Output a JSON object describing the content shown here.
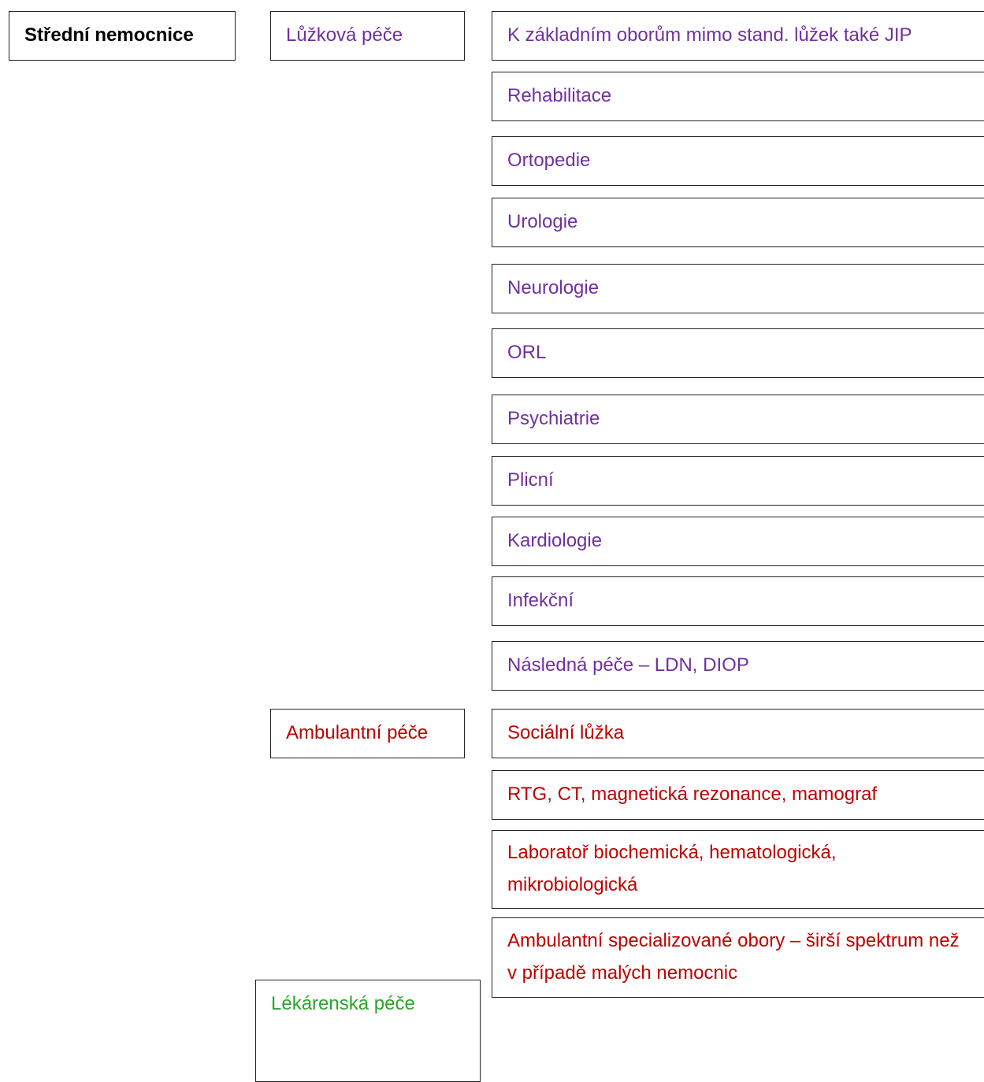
{
  "root": {
    "label": "Střední nemocnice"
  },
  "colors": {
    "inpatient": "#7030a0",
    "ambulatory": "#c00000",
    "pharmacy": "#2aa52a"
  },
  "categories": [
    {
      "label": "Lůžková péče",
      "items": [
        "K základním oborům mimo stand. lůžek také JIP",
        "Rehabilitace",
        "Ortopedie",
        "Urologie",
        "Neurologie",
        "ORL",
        "Psychiatrie",
        "Plicní",
        "Kardiologie",
        "Infekční",
        "Následná péče – LDN, DIOP"
      ]
    },
    {
      "label": "Ambulantní péče",
      "items": [
        "Sociální lůžka",
        "RTG, CT, magnetická rezonance, mamograf",
        "Laboratoř biochemická, hematologická, mikrobiologická",
        "Ambulantní specializované obory – širší spektrum než v případě malých nemocnic"
      ]
    },
    {
      "label": "Lékárenská péče",
      "items": []
    }
  ]
}
